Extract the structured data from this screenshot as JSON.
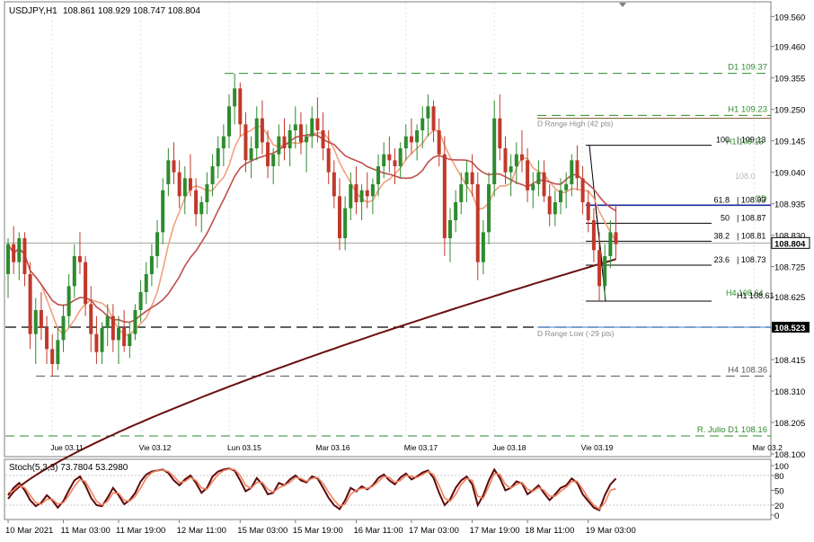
{
  "chart_data": [
    {
      "type": "candlestick",
      "symbol_label": "USDJPY,H1",
      "ohlc_label": "108.861 108.929 108.747 108.804",
      "ylim": [
        108.1,
        109.6
      ],
      "y_ticks": [
        "109.560",
        "109.460",
        "109.355",
        "109.250",
        "109.145",
        "109.040",
        "108.935",
        "108.830",
        "108.725",
        "108.625",
        "108.520",
        "108.415",
        "108.310",
        "108.205",
        "108.100"
      ],
      "current_price_tag": "108.804",
      "current_price": 108.804,
      "level_tag": "108.523",
      "level_price": 108.523,
      "top_axis_labels": [
        {
          "text": "Jue 03.11",
          "bar": 8
        },
        {
          "text": "Vie 03.12",
          "bar": 24
        },
        {
          "text": "Lun 03.15",
          "bar": 40
        },
        {
          "text": "Mar 03.16",
          "bar": 56
        },
        {
          "text": "Mie 03.17",
          "bar": 72
        },
        {
          "text": "Jue 03.18",
          "bar": 88
        },
        {
          "text": "Vie 03.19",
          "bar": 104
        },
        {
          "text": "Mar 03.2",
          "bar": 135
        }
      ],
      "x_labels": [
        {
          "text": "10 Mar 2021",
          "bar": 0
        },
        {
          "text": "11 Mar 03:00",
          "bar": 10
        },
        {
          "text": "11 Mar 19:00",
          "bar": 20
        },
        {
          "text": "12 Mar 11:00",
          "bar": 31
        },
        {
          "text": "15 Mar 03:00",
          "bar": 42
        },
        {
          "text": "15 Mar 19:00",
          "bar": 52
        },
        {
          "text": "16 Mar 11:00",
          "bar": 63
        },
        {
          "text": "17 Mar 03:00",
          "bar": 73
        },
        {
          "text": "17 Mar 19:00",
          "bar": 84
        },
        {
          "text": "18 Mar 11:00",
          "bar": 94
        },
        {
          "text": "19 Mar 03:00",
          "bar": 105
        }
      ],
      "dashed_levels": [
        {
          "price": 109.37,
          "label": "D1 109.37",
          "color": "#2e8b2e"
        },
        {
          "price": 109.23,
          "label": "H1 109.23",
          "color": "#2e8b2e"
        },
        {
          "price": 108.36,
          "label": "H4 108.36",
          "color": "#555555"
        },
        {
          "price": 108.16,
          "label": "R. Julio D1 108.16",
          "color": "#2e8b2e"
        }
      ],
      "range_labels": [
        {
          "price": 109.22,
          "label": "D Range High (42 pts)"
        },
        {
          "price": 108.52,
          "label": "D Range Low (-29 pts)"
        }
      ],
      "fibonacci": [
        {
          "ratio": "100",
          "price": 109.13,
          "label": "| 109.13"
        },
        {
          "ratio": "61.8",
          "price": 108.93,
          "label": "| 108.93"
        },
        {
          "ratio": "50",
          "price": 108.87,
          "label": "| 108.87"
        },
        {
          "ratio": "38.2",
          "price": 108.81,
          "label": "| 108.81"
        },
        {
          "ratio": "23.6",
          "price": 108.73,
          "label": "| 108.73"
        },
        {
          "ratio": "",
          "price": 108.61,
          "label": "H1 108.61"
        }
      ],
      "overlay_labels": [
        {
          "text": "H1 109.13",
          "price": 109.145
        },
        {
          "text": "108.0",
          "price": 109.03
        },
        {
          "text": "OD",
          "price": 108.955
        },
        {
          "text": "H4 108.64",
          "price": 108.64
        }
      ],
      "ohlc": [
        [
          108.7,
          108.82,
          108.62,
          108.8
        ],
        [
          108.8,
          108.86,
          108.7,
          108.74
        ],
        [
          108.74,
          108.84,
          108.68,
          108.82
        ],
        [
          108.82,
          108.84,
          108.66,
          108.7
        ],
        [
          108.7,
          108.74,
          108.45,
          108.5
        ],
        [
          108.5,
          108.62,
          108.4,
          108.58
        ],
        [
          108.58,
          108.64,
          108.48,
          108.52
        ],
        [
          108.52,
          108.56,
          108.4,
          108.45
        ],
        [
          108.45,
          108.5,
          108.36,
          108.4
        ],
        [
          108.4,
          108.52,
          108.38,
          108.48
        ],
        [
          108.48,
          108.6,
          108.44,
          108.56
        ],
        [
          108.56,
          108.7,
          108.52,
          108.66
        ],
        [
          108.66,
          108.8,
          108.62,
          108.76
        ],
        [
          108.76,
          108.84,
          108.7,
          108.74
        ],
        [
          108.74,
          108.76,
          108.56,
          108.6
        ],
        [
          108.6,
          108.66,
          108.44,
          108.5
        ],
        [
          108.5,
          108.56,
          108.4,
          108.44
        ],
        [
          108.44,
          108.54,
          108.4,
          108.52
        ],
        [
          108.52,
          108.6,
          108.46,
          108.56
        ],
        [
          108.56,
          108.6,
          108.44,
          108.48
        ],
        [
          108.48,
          108.56,
          108.4,
          108.52
        ],
        [
          108.52,
          108.58,
          108.44,
          108.46
        ],
        [
          108.46,
          108.54,
          108.42,
          108.5
        ],
        [
          108.5,
          108.6,
          108.48,
          108.58
        ],
        [
          108.58,
          108.68,
          108.54,
          108.64
        ],
        [
          108.64,
          108.74,
          108.6,
          108.7
        ],
        [
          108.7,
          108.8,
          108.66,
          108.76
        ],
        [
          108.76,
          108.88,
          108.72,
          108.84
        ],
        [
          108.84,
          109.02,
          108.8,
          108.98
        ],
        [
          109.0,
          109.12,
          108.96,
          109.08
        ],
        [
          109.08,
          109.14,
          109.0,
          109.04
        ],
        [
          109.04,
          109.08,
          108.92,
          108.96
        ],
        [
          108.96,
          109.06,
          108.9,
          109.02
        ],
        [
          109.02,
          109.1,
          108.96,
          108.98
        ],
        [
          108.98,
          109.02,
          108.86,
          108.9
        ],
        [
          108.9,
          108.96,
          108.84,
          108.94
        ],
        [
          108.94,
          109.04,
          108.9,
          109.0
        ],
        [
          109.0,
          109.1,
          108.96,
          109.06
        ],
        [
          109.06,
          109.16,
          109.02,
          109.12
        ],
        [
          109.12,
          109.2,
          109.06,
          109.16
        ],
        [
          109.16,
          109.3,
          109.12,
          109.26
        ],
        [
          109.26,
          109.37,
          109.2,
          109.32
        ],
        [
          109.32,
          109.34,
          109.16,
          109.2
        ],
        [
          109.2,
          109.24,
          109.04,
          109.08
        ],
        [
          109.08,
          109.16,
          109.02,
          109.12
        ],
        [
          109.12,
          109.26,
          109.08,
          109.22
        ],
        [
          109.22,
          109.28,
          109.1,
          109.14
        ],
        [
          109.14,
          109.18,
          109.02,
          109.06
        ],
        [
          109.06,
          109.12,
          109.0,
          109.1
        ],
        [
          109.1,
          109.2,
          109.06,
          109.16
        ],
        [
          109.16,
          109.22,
          109.08,
          109.12
        ],
        [
          109.12,
          109.2,
          109.06,
          109.18
        ],
        [
          109.18,
          109.26,
          109.12,
          109.2
        ],
        [
          109.2,
          109.24,
          109.1,
          109.14
        ],
        [
          109.14,
          109.2,
          109.04,
          109.16
        ],
        [
          109.16,
          109.26,
          109.12,
          109.22
        ],
        [
          109.22,
          109.29,
          109.14,
          109.18
        ],
        [
          109.18,
          109.24,
          109.08,
          109.12
        ],
        [
          109.12,
          109.18,
          109.0,
          109.04
        ],
        [
          109.04,
          109.08,
          108.92,
          108.96
        ],
        [
          108.96,
          109.02,
          108.78,
          108.82
        ],
        [
          108.82,
          108.96,
          108.78,
          108.92
        ],
        [
          108.92,
          109.04,
          108.88,
          109.0
        ],
        [
          109.0,
          109.06,
          108.9,
          108.94
        ],
        [
          108.94,
          109.0,
          108.88,
          108.98
        ],
        [
          108.98,
          109.04,
          108.92,
          108.96
        ],
        [
          108.96,
          109.02,
          108.9,
          109.0
        ],
        [
          109.0,
          109.1,
          108.96,
          109.06
        ],
        [
          109.06,
          109.14,
          109.02,
          109.1
        ],
        [
          109.1,
          109.16,
          109.04,
          109.08
        ],
        [
          109.08,
          109.12,
          109.0,
          109.06
        ],
        [
          109.06,
          109.14,
          109.02,
          109.12
        ],
        [
          109.12,
          109.2,
          109.08,
          109.16
        ],
        [
          109.16,
          109.22,
          109.1,
          109.14
        ],
        [
          109.14,
          109.2,
          109.08,
          109.18
        ],
        [
          109.18,
          109.26,
          109.12,
          109.22
        ],
        [
          109.22,
          109.3,
          109.16,
          109.26
        ],
        [
          109.26,
          109.28,
          109.14,
          109.18
        ],
        [
          109.18,
          109.22,
          109.06,
          109.1
        ],
        [
          109.1,
          109.16,
          108.76,
          108.82
        ],
        [
          108.82,
          108.92,
          108.74,
          108.88
        ],
        [
          108.88,
          108.98,
          108.84,
          108.94
        ],
        [
          108.94,
          109.04,
          108.9,
          109.0
        ],
        [
          109.0,
          109.08,
          108.94,
          109.04
        ],
        [
          109.04,
          109.1,
          108.96,
          109.0
        ],
        [
          109.0,
          109.04,
          108.68,
          108.74
        ],
        [
          108.74,
          108.88,
          108.7,
          108.84
        ],
        [
          108.84,
          109.04,
          108.8,
          109.0
        ],
        [
          109.0,
          109.28,
          108.96,
          109.22
        ],
        [
          109.22,
          109.3,
          109.08,
          109.12
        ],
        [
          109.12,
          109.16,
          109.0,
          109.04
        ],
        [
          109.04,
          109.1,
          108.96,
          109.06
        ],
        [
          109.06,
          109.14,
          109.0,
          109.1
        ],
        [
          109.1,
          109.18,
          109.04,
          109.08
        ],
        [
          109.08,
          109.12,
          108.94,
          108.98
        ],
        [
          108.98,
          109.04,
          108.92,
          109.0
        ],
        [
          109.0,
          109.08,
          108.96,
          109.04
        ],
        [
          109.04,
          109.08,
          108.94,
          108.96
        ],
        [
          108.96,
          109.0,
          108.86,
          108.9
        ],
        [
          108.9,
          108.98,
          108.86,
          108.94
        ],
        [
          108.94,
          109.02,
          108.9,
          108.98
        ],
        [
          108.98,
          109.04,
          108.92,
          109.0
        ],
        [
          109.0,
          109.1,
          108.96,
          109.08
        ],
        [
          109.08,
          109.13,
          108.98,
          109.02
        ],
        [
          109.02,
          109.06,
          108.9,
          108.94
        ],
        [
          108.94,
          108.98,
          108.84,
          108.88
        ],
        [
          108.88,
          108.92,
          108.74,
          108.78
        ],
        [
          108.78,
          108.84,
          108.61,
          108.66
        ],
        [
          108.66,
          108.8,
          108.62,
          108.76
        ],
        [
          108.76,
          108.88,
          108.72,
          108.84
        ],
        [
          108.84,
          108.93,
          108.75,
          108.8
        ]
      ],
      "moving_averages": [
        {
          "name": "",
          "period": 21,
          "color": "#f2a07b",
          "width": 1.6
        },
        {
          "name": "",
          "period": 50,
          "color": "#c0504d",
          "width": 1.6
        },
        {
          "name": "",
          "period": 200,
          "color": "#6b0f0f",
          "width": 2.0
        }
      ]
    },
    {
      "type": "line",
      "label": "Stoch(5,3,3) 73.7804 53.2980",
      "ylim": [
        0,
        100
      ],
      "y_ticks": [
        "100",
        "80",
        "50",
        "20",
        "0"
      ],
      "series": [
        {
          "name": "",
          "color": "#5c0a0a",
          "values": [
            40,
            55,
            65,
            50,
            30,
            18,
            25,
            40,
            30,
            15,
            28,
            50,
            70,
            78,
            60,
            35,
            20,
            18,
            35,
            55,
            40,
            22,
            30,
            45,
            68,
            82,
            88,
            90,
            92,
            85,
            70,
            60,
            72,
            80,
            65,
            45,
            55,
            78,
            88,
            92,
            94,
            90,
            70,
            48,
            55,
            75,
            62,
            42,
            45,
            65,
            60,
            72,
            80,
            70,
            66,
            78,
            74,
            55,
            35,
            20,
            12,
            30,
            55,
            48,
            58,
            52,
            60,
            75,
            82,
            70,
            62,
            76,
            84,
            72,
            78,
            86,
            90,
            75,
            45,
            20,
            32,
            55,
            70,
            78,
            62,
            20,
            40,
            70,
            92,
            75,
            50,
            55,
            68,
            64,
            42,
            50,
            60,
            44,
            30,
            42,
            55,
            60,
            74,
            65,
            42,
            28,
            15,
            10,
            40,
            62,
            73.8
          ]
        },
        {
          "name": "",
          "color": "#f08060",
          "values": [
            45,
            50,
            60,
            55,
            40,
            25,
            22,
            32,
            32,
            22,
            25,
            40,
            58,
            72,
            68,
            48,
            28,
            20,
            28,
            45,
            44,
            30,
            28,
            38,
            55,
            75,
            86,
            90,
            91,
            88,
            78,
            66,
            68,
            76,
            70,
            55,
            52,
            68,
            82,
            90,
            93,
            92,
            80,
            60,
            54,
            66,
            66,
            52,
            46,
            55,
            60,
            66,
            76,
            74,
            68,
            74,
            76,
            64,
            46,
            30,
            18,
            22,
            42,
            50,
            54,
            54,
            58,
            68,
            78,
            76,
            66,
            70,
            80,
            78,
            76,
            82,
            88,
            82,
            60,
            34,
            28,
            42,
            62,
            74,
            70,
            38,
            34,
            58,
            84,
            82,
            62,
            54,
            62,
            66,
            52,
            48,
            56,
            50,
            38,
            38,
            48,
            56,
            68,
            68,
            52,
            34,
            20,
            12,
            25,
            50,
            53.3
          ]
        }
      ]
    }
  ]
}
